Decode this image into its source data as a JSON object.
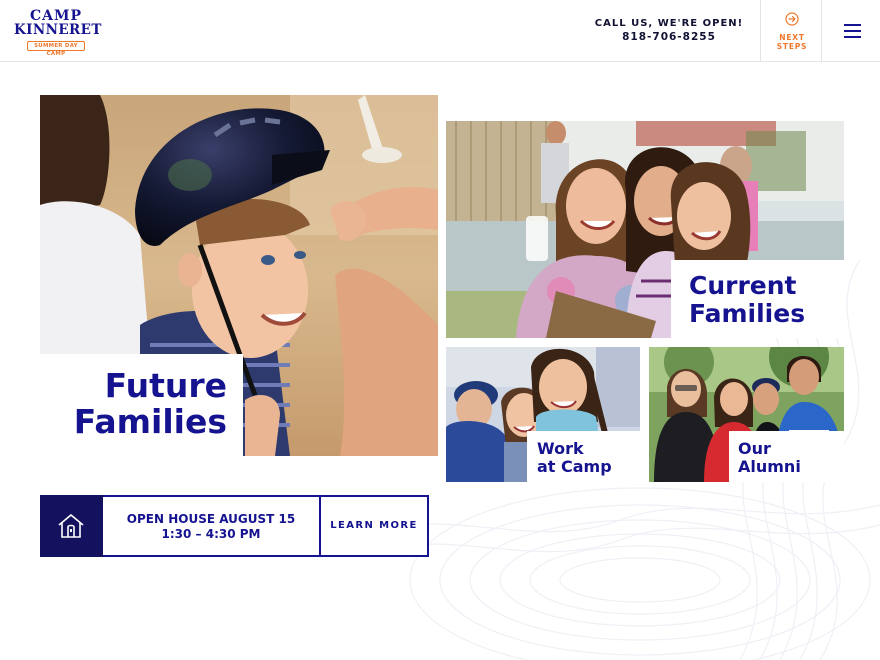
{
  "header": {
    "logo": {
      "line1": "CAMP",
      "line2": "KINNERET",
      "tagline": "SUMMER DAY CAMP"
    },
    "call": {
      "line": "CALL US, WE'RE OPEN!",
      "phone": "818-706-8255"
    },
    "next_steps": {
      "line1": "NEXT",
      "line2": "STEPS",
      "icon": "arrow-circle-right-icon"
    },
    "menu_icon": "hamburger-menu-icon"
  },
  "tiles": {
    "future": {
      "line1": "Future",
      "line2": "Families",
      "photo": "boy-with-bike-helmet-photo"
    },
    "current": {
      "line1": "Current",
      "line2": "Families",
      "photo": "three-smiling-girls-photo"
    },
    "work": {
      "line1": "Work",
      "line2": "at Camp",
      "photo": "counselor-with-campers-photo"
    },
    "alumni": {
      "line1": "Our",
      "line2": "Alumni",
      "photo": "alumni-group-photo"
    }
  },
  "open_house": {
    "icon": "house-icon",
    "line1": "OPEN HOUSE AUGUST 15",
    "line2": "1:30 – 4:30 PM",
    "cta": "LEARN MORE"
  },
  "colors": {
    "navy": "#15138f",
    "dark_navy": "#14125f",
    "orange": "#f0782b"
  }
}
